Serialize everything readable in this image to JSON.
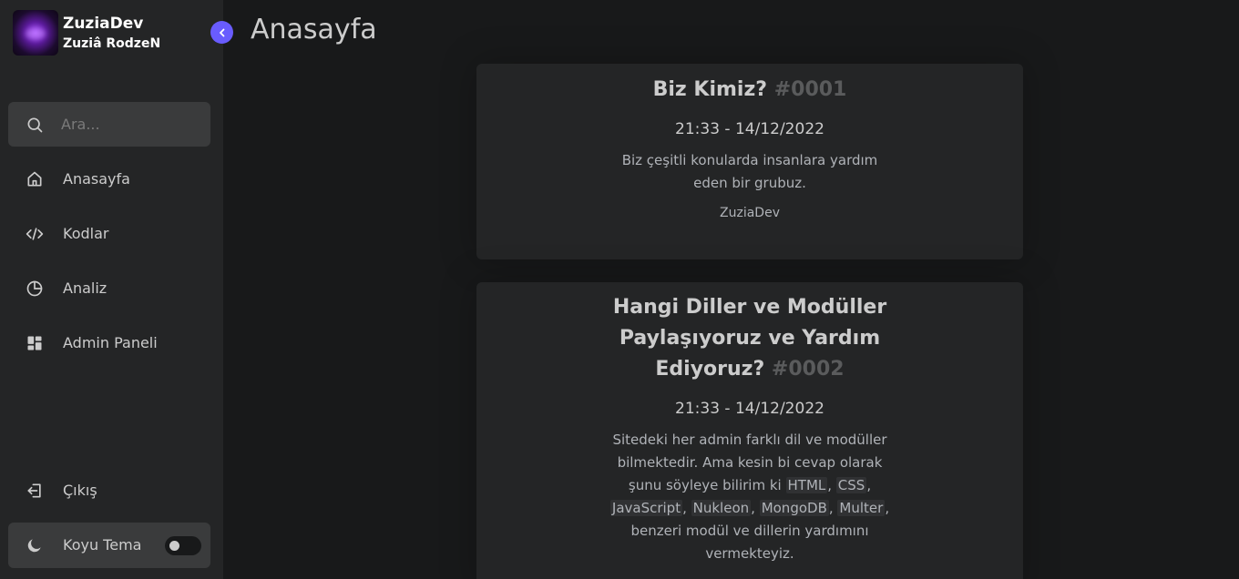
{
  "brand": {
    "name": "ZuziaDev",
    "user": "Zuziâ RodzeN"
  },
  "page_title": "Anasayfa",
  "search": {
    "placeholder": "Ara..."
  },
  "nav": [
    {
      "label": "Anasayfa",
      "icon": "home-icon"
    },
    {
      "label": "Kodlar",
      "icon": "code-icon"
    },
    {
      "label": "Analiz",
      "icon": "pie-chart-icon"
    },
    {
      "label": "Admin Paneli",
      "icon": "dashboard-icon"
    }
  ],
  "logout": {
    "label": "Çıkış",
    "icon": "logout-icon"
  },
  "theme": {
    "label": "Koyu Tema",
    "icon": "moon-icon"
  },
  "posts": [
    {
      "title": "Biz Kimiz?",
      "number": "#0001",
      "time": "21:33 - 14/12/2022",
      "description": "Biz çeşitli konularda insanlara yardım eden bir grubuz.",
      "author": "ZuziaDev"
    },
    {
      "title": "Hangi Diller ve Modüller Paylaşıyoruz ve Yardım Ediyoruz?",
      "number": "#0002",
      "time": "21:33 - 14/12/2022",
      "description_intro": "Sitedeki her admin farklı dil ve modüller bilmektedir. Ama kesin bi cevap olarak şunu söyleye bilirim ki",
      "technologies": [
        "HTML",
        "CSS",
        "JavaScript",
        "Nukleon",
        "MongoDB",
        "Multer"
      ],
      "description_outro": "benzeri modül ve dillerin yardımını vermekteyiz."
    }
  ],
  "colors": {
    "accent": "#695cfe",
    "sidebar_bg": "#242526",
    "page_bg": "#18191a"
  }
}
